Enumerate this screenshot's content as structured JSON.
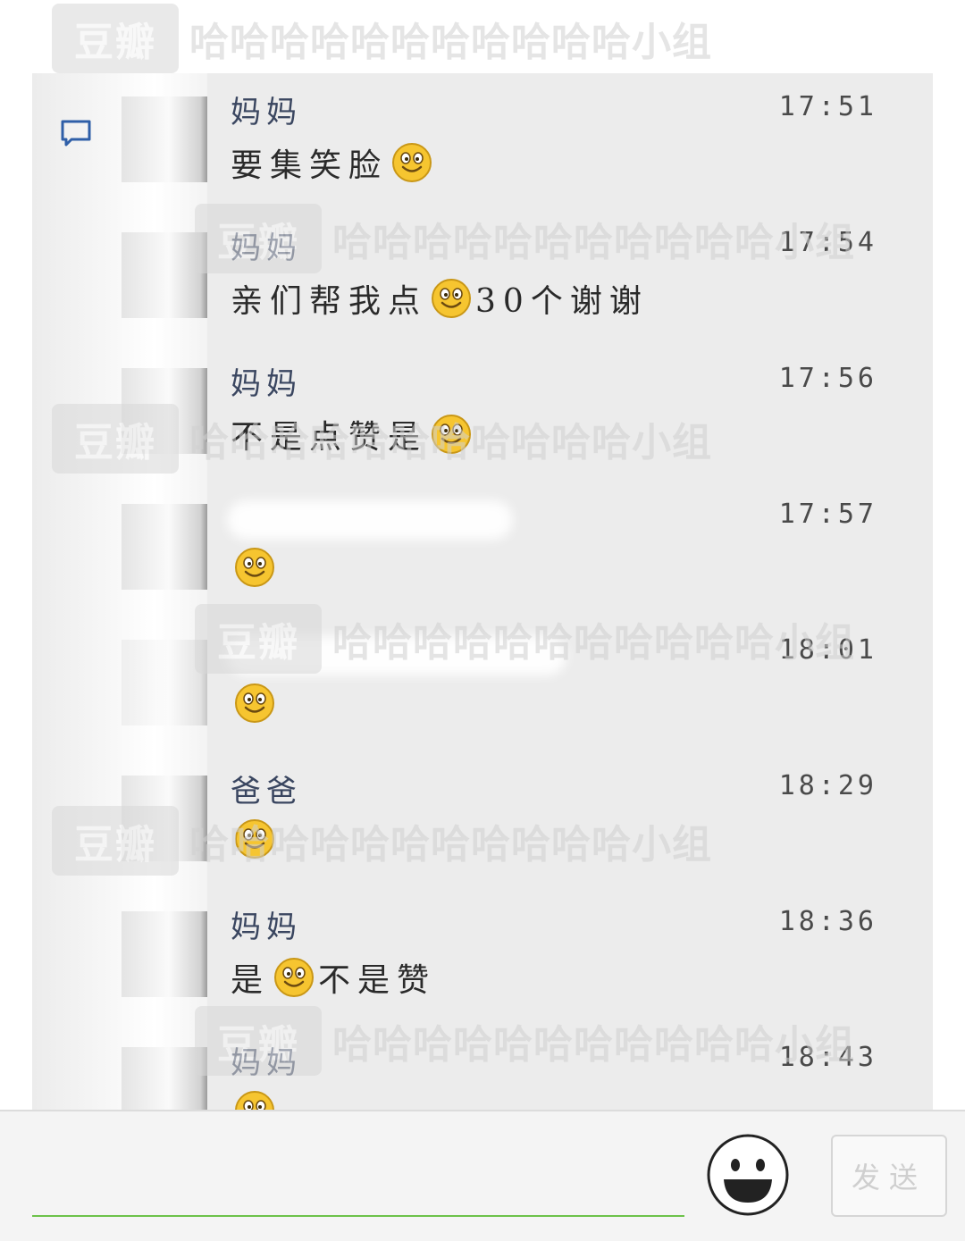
{
  "watermark": {
    "logo": "豆瓣",
    "group": "哈哈哈哈哈哈哈哈哈哈哈小组"
  },
  "messages": [
    {
      "sender": "妈妈",
      "time": "17:51",
      "parts": [
        "要集笑脸",
        ""
      ]
    },
    {
      "sender": "妈妈",
      "time": "17:54",
      "parts": [
        "亲们帮我点",
        "",
        "30个谢谢"
      ]
    },
    {
      "sender": "妈妈",
      "time": "17:56",
      "parts": [
        "不是点赞是",
        ""
      ]
    },
    {
      "sender": "",
      "time": "17:57",
      "parts": [
        ""
      ]
    },
    {
      "sender": "",
      "time": "18:01",
      "parts": [
        ""
      ]
    },
    {
      "sender": "爸爸",
      "time": "18:29",
      "parts": [
        ""
      ]
    },
    {
      "sender": "妈妈",
      "time": "18:36",
      "parts": [
        "是",
        "",
        "不是赞"
      ]
    },
    {
      "sender": "妈妈",
      "time": "18:43",
      "parts": [
        ""
      ]
    }
  ],
  "input": {
    "send_label": "发送"
  },
  "colors": {
    "panel": "#ececec",
    "sender": "#3a4660",
    "input_line": "#6cc24a",
    "smiley": "#f6c530"
  }
}
